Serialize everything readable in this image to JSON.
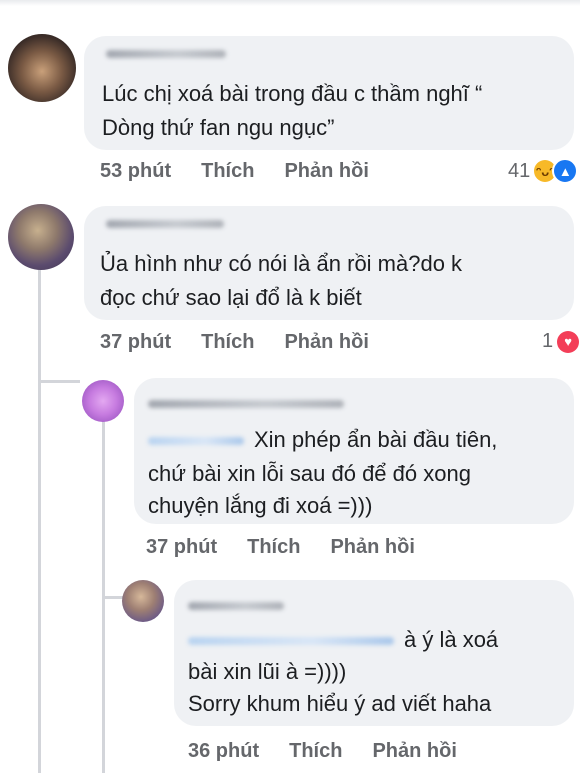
{
  "comments": [
    {
      "text_lines": [
        "Lúc chị xoá bài trong đầu c thầm nghĩ “",
        "Dòng thứ fan ngu ngục”"
      ],
      "time": "53 phút",
      "like": "Thích",
      "reply": "Phản hồi",
      "reaction_count": "41",
      "reaction_icons": [
        "haha-icon",
        "like-icon"
      ]
    },
    {
      "text_lines": [
        "Ủa hình như có nói là ẩn rồi mà?do k",
        "đọc chứ sao lại đổ là k biết"
      ],
      "time": "37 phút",
      "like": "Thích",
      "reply": "Phản hồi",
      "reaction_count": "1",
      "reaction_icons": [
        "love-icon"
      ]
    },
    {
      "text_lines": [
        "Xin phép ẩn bài đầu tiên,",
        "chứ bài xin lỗi sau đó để đó xong",
        "chuyện lắng đi xoá =)))"
      ],
      "time": "37 phút",
      "like": "Thích",
      "reply": "Phản hồi"
    },
    {
      "text_lines": [
        "à ý là xoá",
        "bài xin lũi à =))))",
        "Sorry khum hiểu ý ad viết haha"
      ],
      "time": "36 phút",
      "like": "Thích",
      "reply": "Phản hồi"
    }
  ],
  "colors": {
    "bubble": "#eff1f4",
    "meta_text": "#65676b",
    "like_reaction": "#1877f2",
    "love_reaction": "#f33e58",
    "haha_reaction": "#f7b928"
  }
}
